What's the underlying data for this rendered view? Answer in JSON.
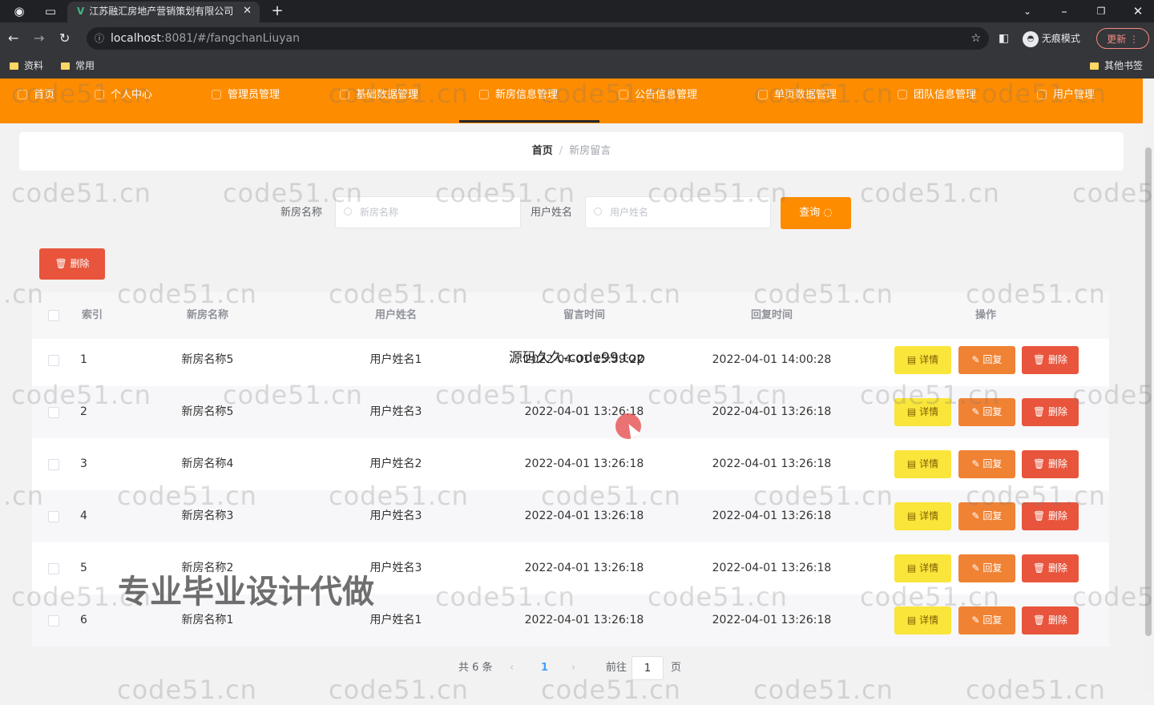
{
  "browser": {
    "tab_title": "江苏融汇房地产营销策划有限公司",
    "tab_favicon": "V",
    "url_host": "localhost",
    "url_rest": ":8081/#/fangchanLiuyan",
    "incognito_label": "无痕模式",
    "update_label": "更新",
    "bookmarks": [
      "资料",
      "常用"
    ],
    "other_bookmarks": "其他书签"
  },
  "nav": {
    "items": [
      "首页",
      "个人中心",
      "管理员管理",
      "基础数据管理",
      "新房信息管理",
      "公告信息管理",
      "单页数据管理",
      "团队信息管理",
      "用户管理"
    ],
    "active_index": 4
  },
  "breadcrumb": {
    "home": "首页",
    "separator": "/",
    "current": "新房留言"
  },
  "search": {
    "house_label": "新房名称",
    "house_placeholder": "新房名称",
    "user_label": "用户姓名",
    "user_placeholder": "用户姓名",
    "query_label": "查询"
  },
  "bulk_delete_label": "删除",
  "table": {
    "columns": [
      "索引",
      "新房名称",
      "用户姓名",
      "留言时间",
      "回复时间",
      "操作"
    ],
    "rows": [
      {
        "index": "1",
        "house": "新房名称5",
        "user": "用户姓名1",
        "msg_time": "2022-04-01 15:59:22",
        "reply_time": "2022-04-01 14:00:28"
      },
      {
        "index": "2",
        "house": "新房名称5",
        "user": "用户姓名3",
        "msg_time": "2022-04-01 13:26:18",
        "reply_time": "2022-04-01 13:26:18"
      },
      {
        "index": "3",
        "house": "新房名称4",
        "user": "用户姓名2",
        "msg_time": "2022-04-01 13:26:18",
        "reply_time": "2022-04-01 13:26:18"
      },
      {
        "index": "4",
        "house": "新房名称3",
        "user": "用户姓名3",
        "msg_time": "2022-04-01 13:26:18",
        "reply_time": "2022-04-01 13:26:18"
      },
      {
        "index": "5",
        "house": "新房名称2",
        "user": "用户姓名3",
        "msg_time": "2022-04-01 13:26:18",
        "reply_time": "2022-04-01 13:26:18"
      },
      {
        "index": "6",
        "house": "新房名称1",
        "user": "用户姓名1",
        "msg_time": "2022-04-01 13:26:18",
        "reply_time": "2022-04-01 13:26:18"
      }
    ],
    "actions": {
      "detail": "详情",
      "reply": "回复",
      "delete": "删除"
    }
  },
  "pagination": {
    "total": "共 6 条",
    "prev": "‹",
    "current": "1",
    "next": "›",
    "goto": "前往",
    "page_input": "1",
    "page_unit": "页"
  },
  "watermarks": {
    "site": "code51.cn",
    "site_cut": "code5",
    "site_tail": ".cn",
    "big": "专业毕业设计代做",
    "mid": "源码久久-code99.top"
  },
  "colors": {
    "nav_bg": "#fe8c00",
    "detail_btn": "#fae53a",
    "reply_btn": "#f08234",
    "delete_btn": "#e8553c"
  }
}
